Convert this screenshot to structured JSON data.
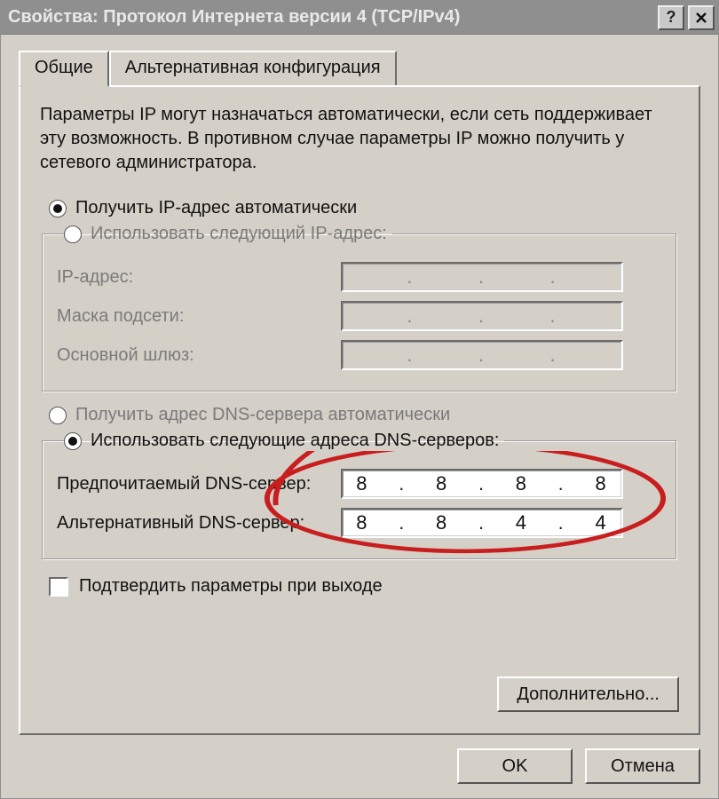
{
  "title": "Свойства: Протокол Интернета версии 4 (TCP/IPv4)",
  "tabs": {
    "general": "Общие",
    "alt": "Альтернативная конфигурация"
  },
  "desc": "Параметры IP могут назначаться автоматически, если сеть поддерживает эту возможность. В противном случае параметры IP можно получить у сетевого администратора.",
  "ip": {
    "auto_label": "Получить IP-адрес автоматически",
    "manual_label": "Использовать следующий IP-адрес:",
    "auto_selected": true,
    "addr_label": "IP-адрес:",
    "mask_label": "Маска подсети:",
    "gw_label": "Основной шлюз:",
    "addr_value": "",
    "mask_value": "",
    "gw_value": ""
  },
  "dns": {
    "auto_label": "Получить адрес DNS-сервера автоматически",
    "manual_label": "Использовать следующие адреса DNS-серверов:",
    "auto_selected": false,
    "pref_label": "Предпочитаемый DNS-сервер:",
    "alt_label": "Альтернативный DNS-сервер:",
    "pref_octets": [
      "8",
      "8",
      "8",
      "8"
    ],
    "alt_octets": [
      "8",
      "8",
      "4",
      "4"
    ]
  },
  "validate_label": "Подтвердить параметры при выходе",
  "advanced_label": "Дополнительно...",
  "ok_label": "OK",
  "cancel_label": "Отмена"
}
